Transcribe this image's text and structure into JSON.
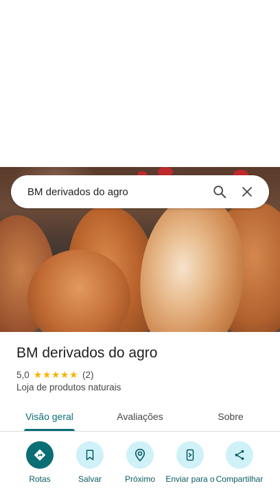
{
  "search": {
    "query": "BM derivados do agro"
  },
  "place": {
    "name": "BM derivados do agro",
    "rating": "5,0",
    "stars": "★★★★★",
    "review_count": "(2)",
    "category": "Loja de produtos naturais"
  },
  "tabs": [
    {
      "label": "Visão geral",
      "active": true
    },
    {
      "label": "Avaliações",
      "active": false
    },
    {
      "label": "Sobre",
      "active": false
    }
  ],
  "actions": [
    {
      "label": "Rotas",
      "icon": "directions-icon"
    },
    {
      "label": "Salvar",
      "icon": "bookmark-icon"
    },
    {
      "label": "Próximo",
      "icon": "nearby-icon"
    },
    {
      "label": "Enviar para o",
      "icon": "send-to-phone-icon"
    },
    {
      "label": "Compartilhar",
      "icon": "share-icon"
    }
  ],
  "colors": {
    "accent": "#0b6e75",
    "chip": "#cff1f8",
    "star": "#f5b400"
  }
}
